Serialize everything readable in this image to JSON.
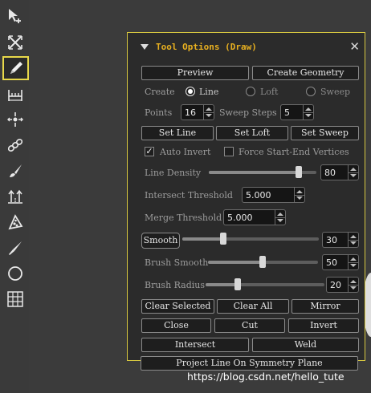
{
  "toolbar": {
    "tools": [
      {
        "icon": "select-add-arrow-icon"
      },
      {
        "icon": "cross-arrows-icon"
      },
      {
        "icon": "pencil-draw-icon",
        "active": true
      },
      {
        "icon": "ruler-measure-icon"
      },
      {
        "icon": "move-point-icon"
      },
      {
        "icon": "chain-links-icon"
      },
      {
        "icon": "brush-icon"
      },
      {
        "icon": "extrude-arrows-icon"
      },
      {
        "icon": "pizza-slice-icon"
      },
      {
        "icon": "knife-icon"
      },
      {
        "icon": "circle-icon"
      },
      {
        "icon": "grid-icon"
      }
    ]
  },
  "panel": {
    "title": "Tool Options (Draw)",
    "close": "✕",
    "preview": "Preview",
    "create_geometry": "Create Geometry",
    "create_label": "Create",
    "create_options": [
      "Line",
      "Loft",
      "Sweep"
    ],
    "create_selected": "Line",
    "points_label": "Points",
    "points_value": "16",
    "sweep_steps_label": "Sweep Steps",
    "sweep_steps_value": "5",
    "set_line": "Set Line",
    "set_loft": "Set Loft",
    "set_sweep": "Set Sweep",
    "auto_invert_label": "Auto Invert",
    "auto_invert_checked": true,
    "force_label": "Force Start-End Vertices",
    "force_checked": false,
    "line_density_label": "Line Density",
    "line_density_value": "80",
    "intersect_threshold_label": "Intersect Threshold",
    "intersect_threshold_value": "5.000",
    "merge_threshold_label": "Merge Threshold",
    "merge_threshold_value": "5.000",
    "smooth_button": "Smooth",
    "smooth_value": "30",
    "brush_smooth_label": "Brush Smooth",
    "brush_smooth_value": "50",
    "brush_radius_label": "Brush Radius",
    "brush_radius_value": "20",
    "clear_selected": "Clear Selected",
    "clear_all": "Clear All",
    "mirror": "Mirror",
    "close_btn": "Close",
    "cut": "Cut",
    "invert": "Invert",
    "intersect": "Intersect",
    "weld": "Weld",
    "project": "Project Line On Symmetry Plane"
  },
  "watermark": "https://blog.csdn.net/hello_tute",
  "colors": {
    "title": "#e8b020",
    "active_border": "#e8d84a",
    "panel_bg": "#2b2b2b"
  }
}
